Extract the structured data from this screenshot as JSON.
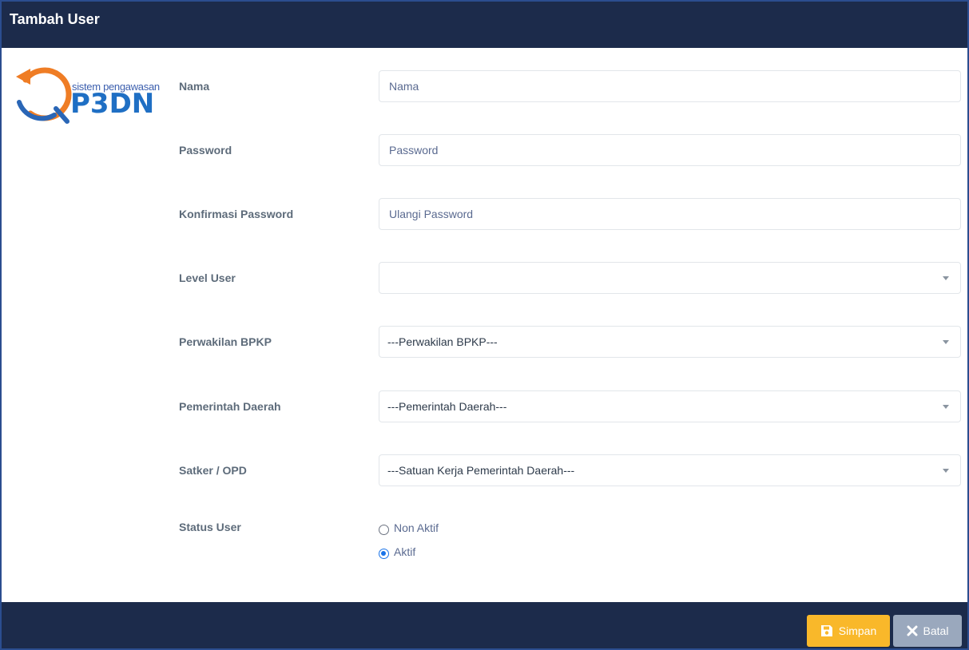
{
  "modal": {
    "title": "Tambah User"
  },
  "logo": {
    "small_text": "sistem pengawasan",
    "big_text": "P3DN"
  },
  "form": {
    "nama": {
      "label": "Nama",
      "placeholder": "Nama",
      "value": ""
    },
    "password": {
      "label": "Password",
      "placeholder": "Password",
      "value": ""
    },
    "konfirmasi": {
      "label": "Konfirmasi Password",
      "placeholder": "Ulangi Password",
      "value": ""
    },
    "level_user": {
      "label": "Level User",
      "selected": ""
    },
    "perwakilan": {
      "label": "Perwakilan BPKP",
      "selected": "---Perwakilan BPKP---"
    },
    "pemda": {
      "label": "Pemerintah Daerah",
      "selected": "---Pemerintah Daerah---"
    },
    "satker": {
      "label": "Satker / OPD",
      "selected": "---Satuan Kerja Pemerintah Daerah---"
    },
    "status": {
      "label": "Status User",
      "options": [
        {
          "label": "Non Aktif",
          "checked": false
        },
        {
          "label": "Aktif",
          "checked": true
        }
      ]
    }
  },
  "footer": {
    "save_label": "Simpan",
    "cancel_label": "Batal"
  },
  "icons": {
    "save": "floppy-disk-icon",
    "cancel": "close-icon",
    "dropdown": "caret-down-icon"
  },
  "colors": {
    "header_bg": "#1c2b4b",
    "save_button": "#f9b82a",
    "cancel_button": "#9aa8bd",
    "radio_checked": "#1a73e8"
  }
}
